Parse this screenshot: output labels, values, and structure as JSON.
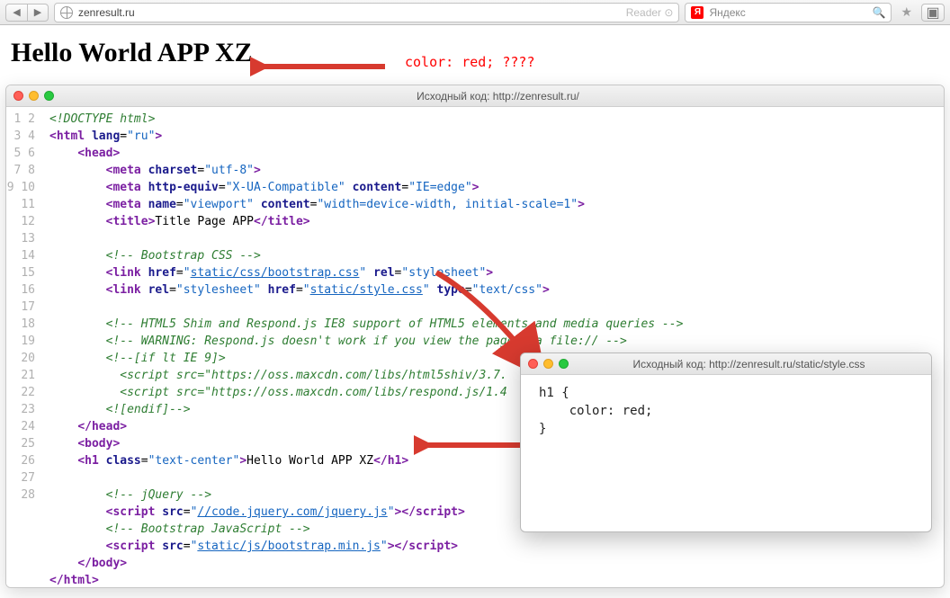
{
  "chrome": {
    "url": "zenresult.ru",
    "reader_label": "Reader",
    "search_placeholder": "Яндекс"
  },
  "page": {
    "heading": "Hello World APP XZ",
    "annotation": "color: red; ????"
  },
  "source_window": {
    "title": "Исходный код: http://zenresult.ru/",
    "line_count": 28,
    "code": {
      "l1": "<!DOCTYPE html>",
      "l2a": "html",
      "l2b": "lang",
      "l2c": "\"ru\"",
      "l3": "head",
      "l4a": "meta",
      "l4b": "charset",
      "l4c": "\"utf-8\"",
      "l5a": "meta",
      "l5b": "http-equiv",
      "l5c": "\"X-UA-Compatible\"",
      "l5d": "content",
      "l5e": "\"IE=edge\"",
      "l6a": "meta",
      "l6b": "name",
      "l6c": "\"viewport\"",
      "l6d": "content",
      "l6e": "\"width=device-width, initial-scale=1\"",
      "l7a": "title",
      "l7b": "Title Page APP",
      "l9": "<!-- Bootstrap CSS -->",
      "l10a": "link",
      "l10b": "href",
      "l10c": "static/css/bootstrap.css",
      "l10d": "rel",
      "l10e": "\"stylesheet\"",
      "l11a": "link",
      "l11b": "rel",
      "l11c": "\"stylesheet\"",
      "l11d": "href",
      "l11e": "static/style.css",
      "l11f": "type",
      "l11g": "\"text/css\"",
      "l13": "<!-- HTML5 Shim and Respond.js IE8 support of HTML5 elements and media queries -->",
      "l14": "<!-- WARNING: Respond.js doesn't work if you view the page via file:// -->",
      "l15": "<!--[if lt IE 9]>",
      "l16": "<script src=\"https://oss.maxcdn.com/libs/html5shiv/3.7.",
      "l17": "<script src=\"https://oss.maxcdn.com/libs/respond.js/1.4",
      "l18": "<![endif]-->",
      "l19": "head",
      "l20": "body",
      "l21a": "h1",
      "l21b": "class",
      "l21c": "\"text-center\"",
      "l21d": "Hello World APP XZ",
      "l23": "<!-- jQuery -->",
      "l24a": "script",
      "l24b": "src",
      "l24c": "//code.jquery.com/jquery.js",
      "l25": "<!-- Bootstrap JavaScript -->",
      "l26a": "script",
      "l26b": "src",
      "l26c": "static/js/bootstrap.min.js",
      "l27": "body",
      "l28": "html"
    }
  },
  "css_window": {
    "title": "Исходный код: http://zenresult.ru/static/style.css",
    "body": "h1 {\n    color: red;\n}"
  }
}
